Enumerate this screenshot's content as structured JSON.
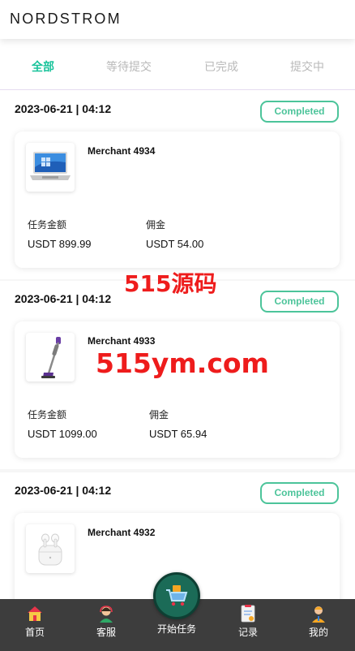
{
  "header": {
    "logo": "NORDSTROM"
  },
  "tabs": [
    {
      "label": "全部",
      "active": true
    },
    {
      "label": "等待提交",
      "active": false
    },
    {
      "label": "已完成",
      "active": false
    },
    {
      "label": "提交中",
      "active": false
    }
  ],
  "orders": [
    {
      "datetime": "2023-06-21 | 04:12",
      "status": "Completed",
      "merchant": "Merchant 4934",
      "product_icon": "laptop-icon",
      "amount_label": "任务金额",
      "amount": "USDT 899.99",
      "commission_label": "佣金",
      "commission": "USDT 54.00"
    },
    {
      "datetime": "2023-06-21 | 04:12",
      "status": "Completed",
      "merchant": "Merchant 4933",
      "product_icon": "vacuum-icon",
      "amount_label": "任务金额",
      "amount": "USDT 1099.00",
      "commission_label": "佣金",
      "commission": "USDT 65.94"
    },
    {
      "datetime": "2023-06-21 | 04:12",
      "status": "Completed",
      "merchant": "Merchant 4932",
      "product_icon": "earbuds-icon"
    }
  ],
  "watermarks": [
    "515源码",
    "515ym.com"
  ],
  "bottom_nav": {
    "home": "首页",
    "support": "客服",
    "start_task": "开始任务",
    "records": "记录",
    "profile": "我的"
  },
  "colors": {
    "accent": "#19c39b",
    "status_green": "#4cc49a",
    "nav_bg": "#3d3d3d",
    "watermark_red": "#ee1c1c"
  }
}
